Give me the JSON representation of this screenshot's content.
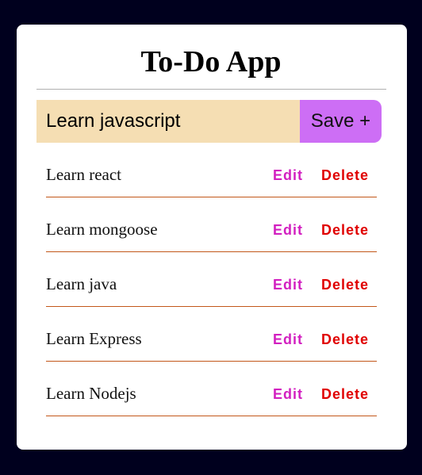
{
  "app": {
    "title": "To-Do App"
  },
  "form": {
    "input_value": "Learn javascript",
    "save_label": "Save +"
  },
  "todos": [
    {
      "text": "Learn react",
      "edit_label": "Edit",
      "delete_label": "Delete"
    },
    {
      "text": "Learn mongoose",
      "edit_label": "Edit",
      "delete_label": "Delete"
    },
    {
      "text": "Learn java",
      "edit_label": "Edit",
      "delete_label": "Delete"
    },
    {
      "text": "Learn Express",
      "edit_label": "Edit",
      "delete_label": "Delete"
    },
    {
      "text": "Learn Nodejs",
      "edit_label": "Edit",
      "delete_label": "Delete"
    }
  ],
  "colors": {
    "page_background": "#00001e",
    "card_background": "#ffffff",
    "input_background": "#f5deb3",
    "save_button": "#cd6ef5",
    "edit_text": "#d21fc0",
    "delete_text": "#e00000",
    "item_divider": "#c2571a"
  }
}
